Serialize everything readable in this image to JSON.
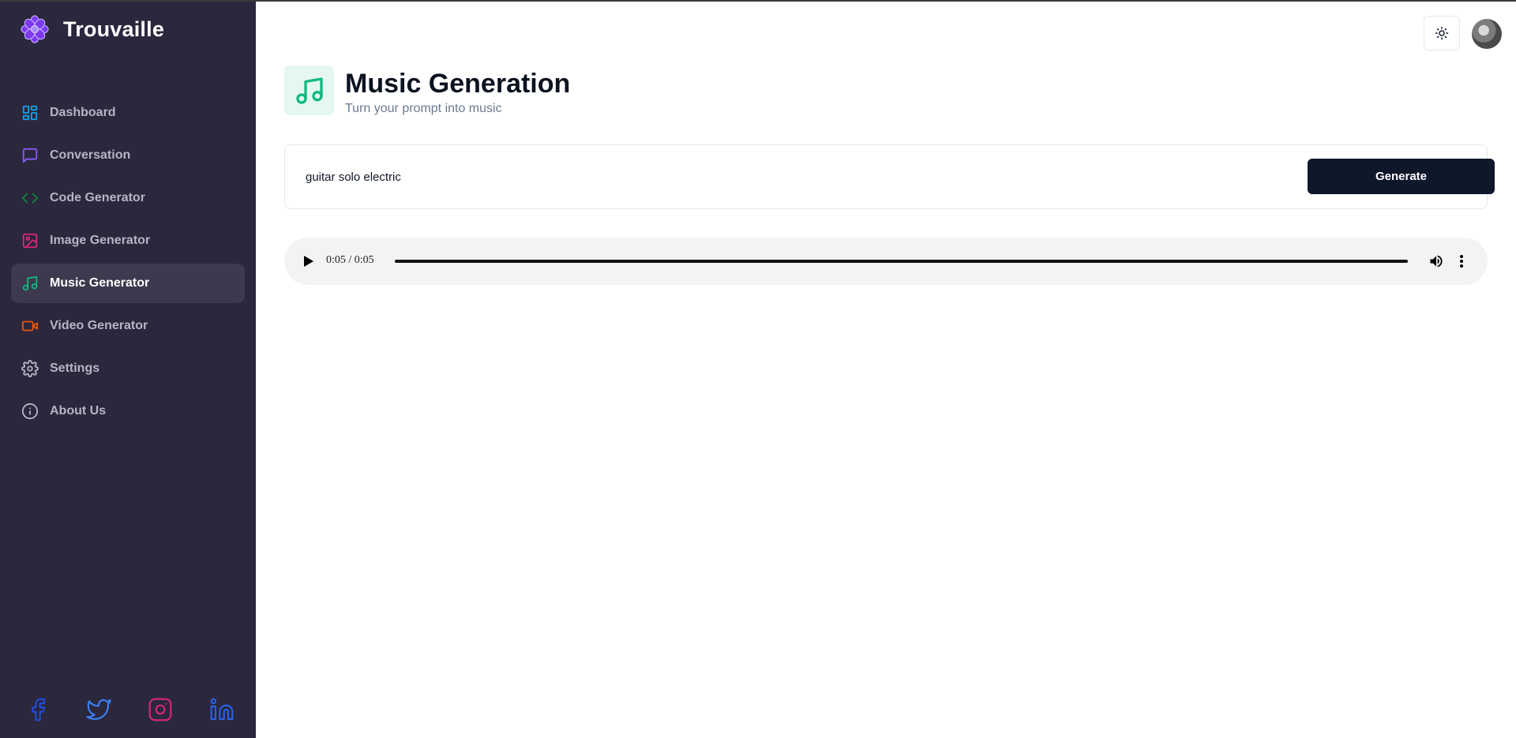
{
  "brand": {
    "name": "Trouvaille"
  },
  "sidebar": {
    "items": [
      {
        "label": "Dashboard",
        "icon": "dashboard-icon",
        "color": "#0ea5e9",
        "active": false
      },
      {
        "label": "Conversation",
        "icon": "message-square-icon",
        "color": "#8b5cf6",
        "active": false
      },
      {
        "label": "Code Generator",
        "icon": "code-icon",
        "color": "#15803d",
        "active": false
      },
      {
        "label": "Image Generator",
        "icon": "image-icon",
        "color": "#db2777",
        "active": false
      },
      {
        "label": "Music Generator",
        "icon": "music-icon",
        "color": "#10b981",
        "active": true
      },
      {
        "label": "Video Generator",
        "icon": "video-icon",
        "color": "#ea580c",
        "active": false
      },
      {
        "label": "Settings",
        "icon": "gear-icon",
        "color": "#b7b4c4",
        "active": false
      },
      {
        "label": "About Us",
        "icon": "info-icon",
        "color": "#b7b4c4",
        "active": false
      }
    ],
    "socials": [
      {
        "name": "facebook-icon",
        "color": "#1d4ed8"
      },
      {
        "name": "twitter-icon",
        "color": "#3b82f6"
      },
      {
        "name": "instagram-icon",
        "color": "#db2777"
      },
      {
        "name": "linkedin-icon",
        "color": "#2563eb"
      }
    ]
  },
  "header": {
    "theme_toggle_icon": "sun-icon"
  },
  "main": {
    "title": "Music Generation",
    "subtitle": "Turn your prompt into music",
    "icon": "music-icon",
    "icon_color": "#10b981",
    "icon_bg": "#e6f7f0",
    "prompt": {
      "value": "guitar solo electric"
    },
    "generate_label": "Generate",
    "audio": {
      "current_time": "0:05",
      "separator": "/",
      "duration": "0:05",
      "progress": 1.0
    }
  }
}
